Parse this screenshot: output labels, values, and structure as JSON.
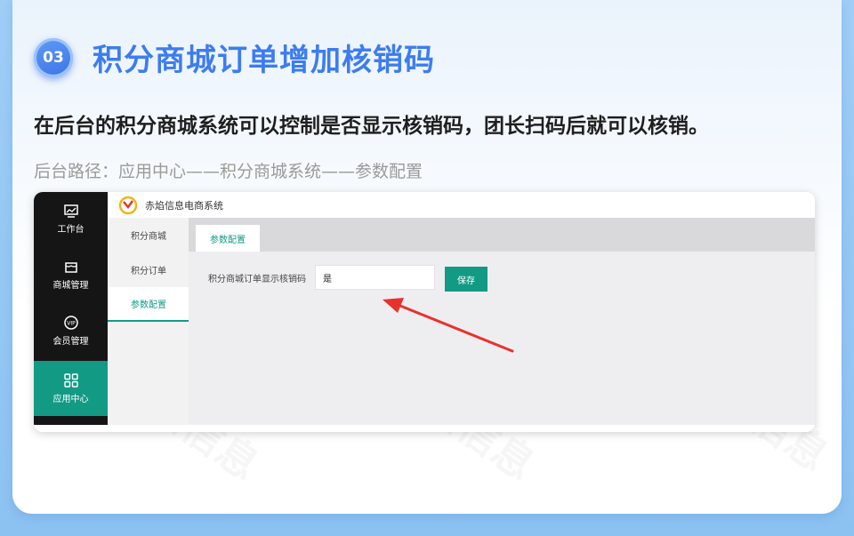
{
  "slide": {
    "step_number": "03",
    "title": "积分商城订单增加核销码",
    "description": "在后台的积分商城系统可以控制是否显示核销码，团长扫码后就可以核销。",
    "path": "后台路径：应用中心——积分商城系统——参数配置",
    "watermark_text": "赤焰信息"
  },
  "admin": {
    "brand": "赤焰信息电商系统",
    "sidebar": [
      {
        "label": "工作台",
        "icon": "dashboard-icon"
      },
      {
        "label": "商城管理",
        "icon": "shop-icon"
      },
      {
        "label": "会员管理",
        "icon": "vip-icon"
      },
      {
        "label": "应用中心",
        "icon": "apps-icon"
      }
    ],
    "subnav": [
      {
        "label": "积分商城"
      },
      {
        "label": "积分订单"
      },
      {
        "label": "参数配置"
      }
    ],
    "tab_label": "参数配置",
    "form": {
      "label": "积分商城订单显示核销码",
      "value": "是",
      "save_label": "保存"
    }
  },
  "colors": {
    "accent": "#129a85",
    "title_blue": "#3d7cf0",
    "arrow_red": "#e8322e"
  }
}
